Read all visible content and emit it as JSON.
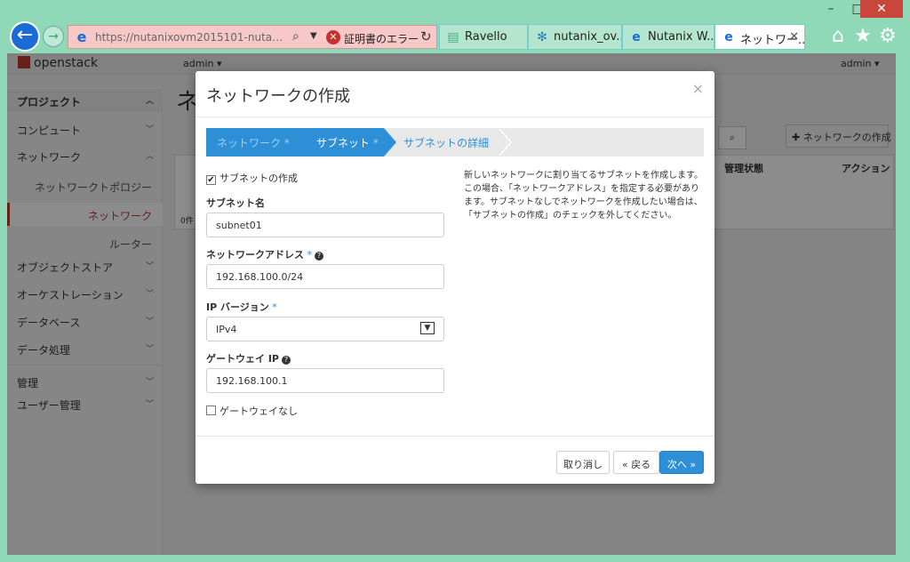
{
  "window": {
    "minimize": "–",
    "maximize": "□",
    "close": "✕"
  },
  "browser": {
    "back": "←",
    "forward": "→",
    "url": "https://nutanixovm2015101-nutan...",
    "cert_error": "証明書のエラー",
    "tabs": [
      {
        "label": "Ravello"
      },
      {
        "label": "nutanix_ov..."
      },
      {
        "label": "Nutanix W..."
      },
      {
        "label": "ネットワー..."
      }
    ]
  },
  "openstack": {
    "logo": "openstack",
    "project": "admin ▾",
    "user": "admin ▾",
    "page_title_partial": "ネ",
    "create_network_btn": "✚ ネットワークの作成",
    "table_headers": [
      "管理状態",
      "アクション"
    ],
    "table_count": "0件"
  },
  "sidebar": {
    "project": "プロジェクト",
    "compute": "コンピュート",
    "network": "ネットワーク",
    "network_topology": "ネットワークトポロジー",
    "networks": "ネットワーク",
    "routers": "ルーター",
    "object_store": "オブジェクトストア",
    "orchestration": "オーケストレーション",
    "database": "データベース",
    "data_processing": "データ処理",
    "admin": "管理",
    "identity": "ユーザー管理"
  },
  "modal": {
    "title": "ネットワークの作成",
    "close": "×",
    "wizard": {
      "step1": "ネットワーク",
      "step2": "サブネット",
      "step3": "サブネットの詳細",
      "asterisk": "*"
    },
    "form": {
      "create_subnet_label": "サブネットの作成",
      "create_subnet_checked": "✔",
      "subnet_name_label": "サブネット名",
      "subnet_name_value": "subnet01",
      "network_address_label": "ネットワークアドレス",
      "network_address_value": "192.168.100.0/24",
      "ip_version_label": "IP バージョン",
      "ip_version_value": "IPv4",
      "gateway_ip_label": "ゲートウェイ IP",
      "gateway_ip_value": "192.168.100.1",
      "no_gateway_label": "ゲートウェイなし",
      "required_mark": "*",
      "help_mark": "?"
    },
    "help_text": "新しいネットワークに割り当てるサブネットを作成します。この場合、「ネットワークアドレス」を指定する必要があります。サブネットなしでネットワークを作成したい場合は、「サブネットの作成」のチェックを外してください。",
    "buttons": {
      "cancel": "取り消し",
      "back": "« 戻る",
      "next": "次へ »"
    }
  }
}
